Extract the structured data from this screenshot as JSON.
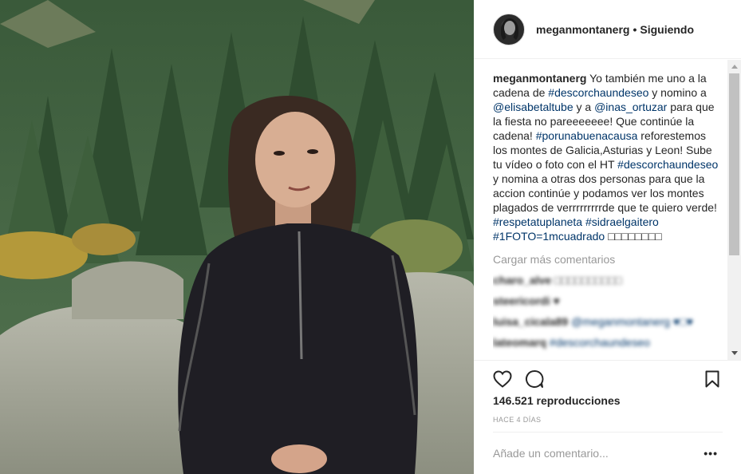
{
  "header": {
    "username": "meganmontanerg",
    "separator": "•",
    "follow_status": "Siguiendo"
  },
  "caption": {
    "username": "meganmontanerg",
    "segments": [
      {
        "text": " Yo también me uno a la cadena de ",
        "tag": false
      },
      {
        "text": "#descorchaundeseo",
        "tag": true
      },
      {
        "text": " y nomino a ",
        "tag": false
      },
      {
        "text": "@elisabetaltube",
        "tag": true
      },
      {
        "text": " y a ",
        "tag": false
      },
      {
        "text": "@inas_ortuzar",
        "tag": true
      },
      {
        "text": " para que la fiesta no pareeeeeee! Que continúe la cadena! ",
        "tag": false
      },
      {
        "text": "#porunabuenacausa",
        "tag": true
      },
      {
        "text": " reforestemos los montes de Galicia,Asturias y Leon! Sube tu vídeo o foto con el HT ",
        "tag": false
      },
      {
        "text": "#descorchaundeseo",
        "tag": true
      },
      {
        "text": " y nomina a otras dos personas para que la accion continúe y podamos ver los montes plagados de verrrrrrrrrde que te quiero verde! ",
        "tag": false
      },
      {
        "text": "#respetatuplaneta",
        "tag": true
      },
      {
        "text": " ",
        "tag": false
      },
      {
        "text": "#sidraelgaitero",
        "tag": true
      },
      {
        "text": " ",
        "tag": false
      },
      {
        "text": "#1FOTO=1mcuadrado",
        "tag": true
      },
      {
        "text": " □□□□□□□□",
        "tag": false
      }
    ]
  },
  "load_more": "Cargar más comentarios",
  "comments": [
    {
      "user": "charo_alve",
      "text": "□□□□□□□□□□"
    },
    {
      "user": "steericordi",
      "text": "♥"
    },
    {
      "user": "luisa_cicala89",
      "text": "@meganmontanerg ♥□♥"
    },
    {
      "user": "lateomarq",
      "text": "#descorchaundeseo"
    }
  ],
  "stats": {
    "views": "146.521 reproducciones",
    "time": "HACE 4 DÍAS"
  },
  "add_comment": {
    "placeholder": "Añade un comentario...",
    "more": "•••"
  },
  "icons": {
    "like": "heart-icon",
    "comment": "comment-bubble-icon",
    "save": "bookmark-icon"
  }
}
